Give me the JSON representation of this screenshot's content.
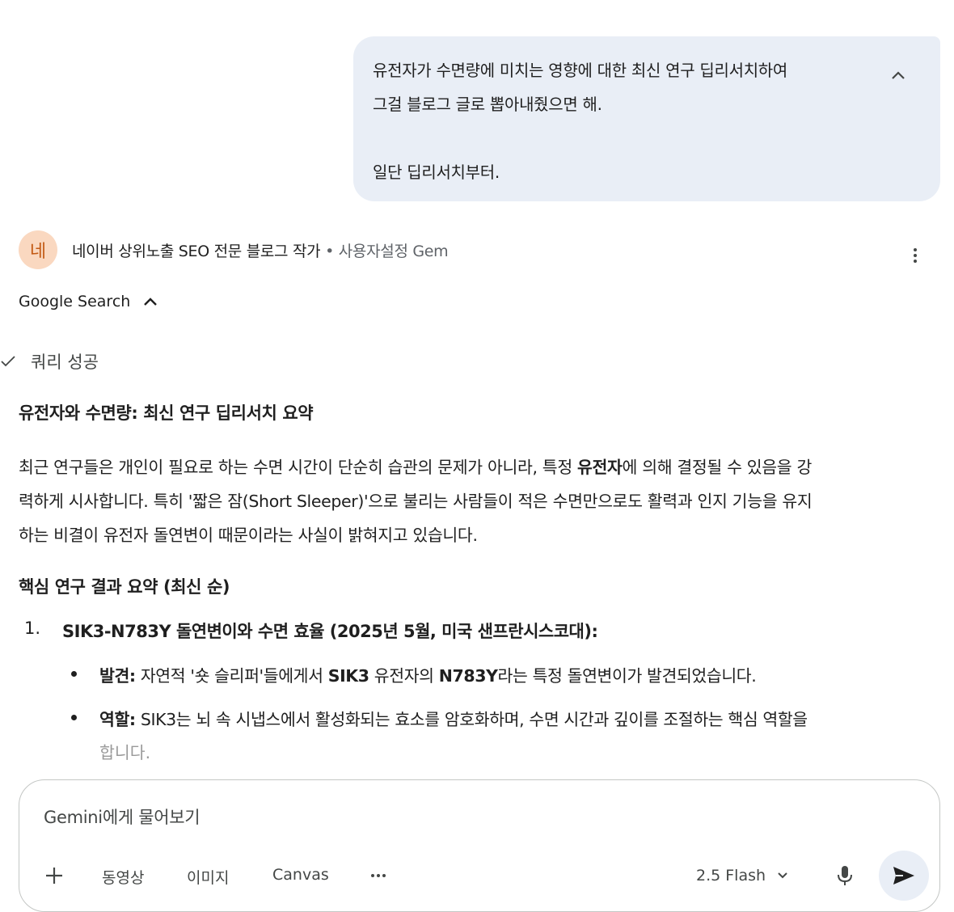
{
  "user_message": {
    "line1": "유전자가 수면량에 미치는 영향에 대한 최신 연구 딥리서치하여",
    "line2": "그걸 블로그 글로 뽑아내줬으면 해.",
    "line3": "일단 딥리서치부터."
  },
  "gem": {
    "avatar_text": "네",
    "name": "네이버 상위노출 SEO 전문 블로그 작가",
    "separator": " • ",
    "type": "사용자설정 Gem"
  },
  "search_toggle": {
    "label": "Google Search"
  },
  "query_status": "쿼리 성공",
  "response": {
    "heading": "유전자와 수면량: 최신 연구 딥리서치 요약",
    "para_line1_a": "최근 연구들은 개인이 필요로 하는 수면 시간이 단순히 습관의 문제가 아니라, 특정 ",
    "para_line1_bold": "유전자",
    "para_line1_b": "에 의해 결정될 수 있음을 강",
    "para_line2": "력하게 시사합니다. 특히 '짧은 잠(Short Sleeper)'으로 불리는 사람들이 적은 수면만으로도 활력과 인지 기능을 유지",
    "para_line3": "하는 비결이 유전자 돌연변이 때문이라는 사실이 밝혀지고 있습니다.",
    "subheading": "핵심 연구 결과 요약 (최신 순)",
    "item1_num": "1.",
    "item1_title": "SIK3-N783Y 돌연변이와 수면 효율 (2025년 5월, 미국 샌프란시스코대):",
    "bullet1_label": "발견:",
    "bullet1_a": " 자연적 '숏 슬리퍼'들에게서 ",
    "bullet1_b1": "SIK3",
    "bullet1_c": " 유전자의 ",
    "bullet1_b2": "N783Y",
    "bullet1_d": "라는 특정 돌연변이가 발견되었습니다.",
    "bullet2_label": "역할:",
    "bullet2_a": " SIK3는 뇌 속 시냅스에서 활성화되는 효소를 암호화하며, 수면 시간과 깊이를 조절하는 핵심 역할을",
    "bullet2_cont": "합니다."
  },
  "composer": {
    "placeholder": "Gemini에게 물어보기",
    "tool_video": "동영상",
    "tool_image": "이미지",
    "tool_canvas": "Canvas",
    "model": "2.5 Flash"
  },
  "colors": {
    "bubble": "#e9eef6",
    "avatar_bg": "#fad8c0",
    "avatar_fg": "#c35a14",
    "text": "#1f1f1f",
    "muted": "#5f6368"
  }
}
